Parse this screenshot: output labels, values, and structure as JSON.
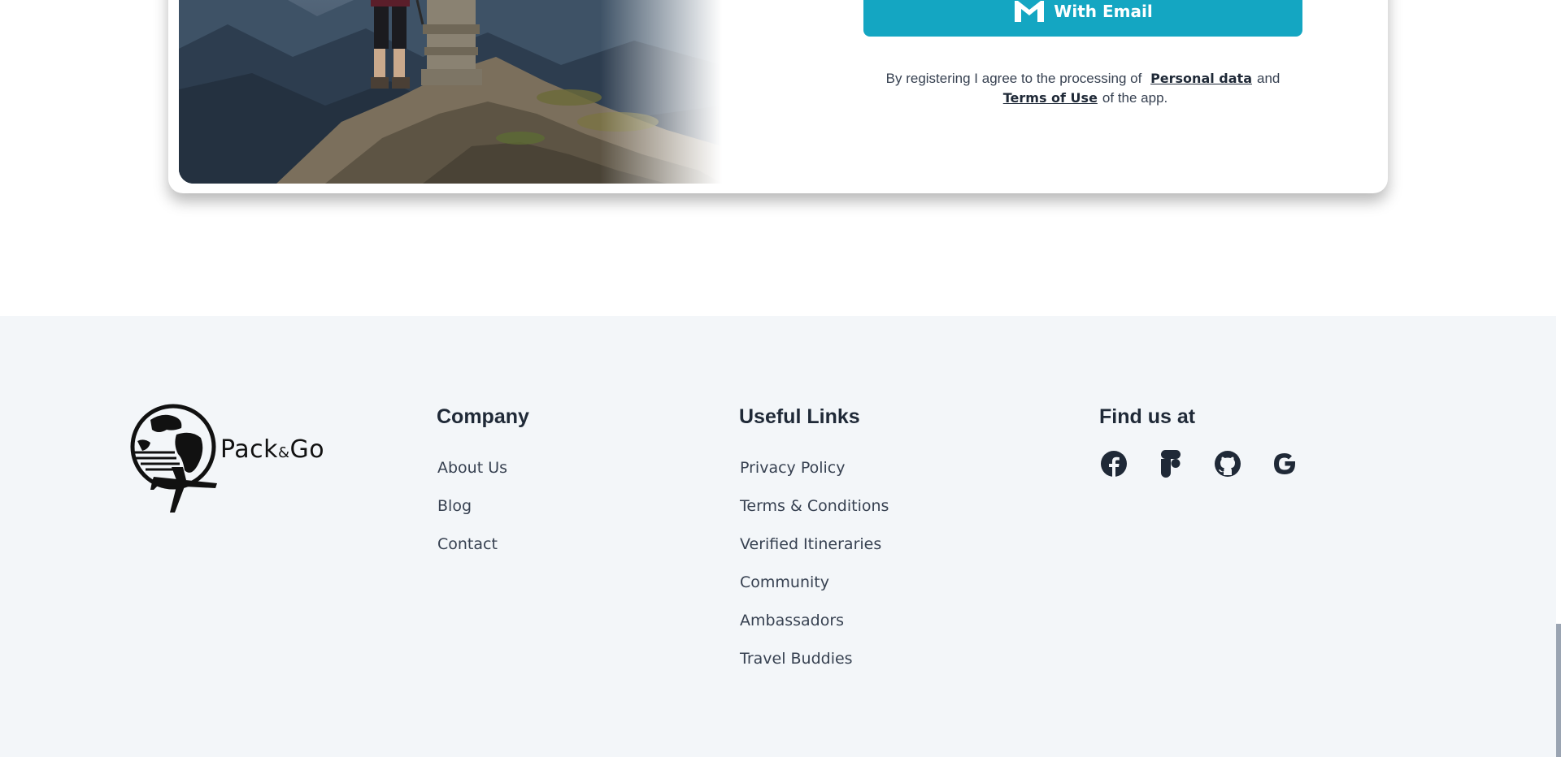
{
  "signup": {
    "email_button_label": "With Email",
    "consent_prefix": "By registering I agree to the processing of",
    "personal_data_link": "Personal data",
    "consent_and": "and",
    "terms_link": "Terms of Use",
    "consent_suffix": "of the app."
  },
  "footer": {
    "brand": {
      "name_part1": "Pack",
      "name_amp": "&",
      "name_part2": "Go"
    },
    "company": {
      "heading": "Company",
      "links": [
        "About Us",
        "Blog",
        "Contact"
      ]
    },
    "useful_links": {
      "heading": "Useful Links",
      "links": [
        "Privacy Policy",
        "Terms & Conditions",
        "Verified Itineraries",
        "Community",
        "Ambassadors",
        "Travel Buddies"
      ]
    },
    "find_us": {
      "heading": "Find us at",
      "icons": [
        "facebook-icon",
        "figma-icon",
        "github-icon",
        "google-icon"
      ]
    }
  },
  "colors": {
    "accent": "#14a6c2",
    "footer_bg": "#f3f6f9",
    "text_dark": "#1f2937"
  }
}
